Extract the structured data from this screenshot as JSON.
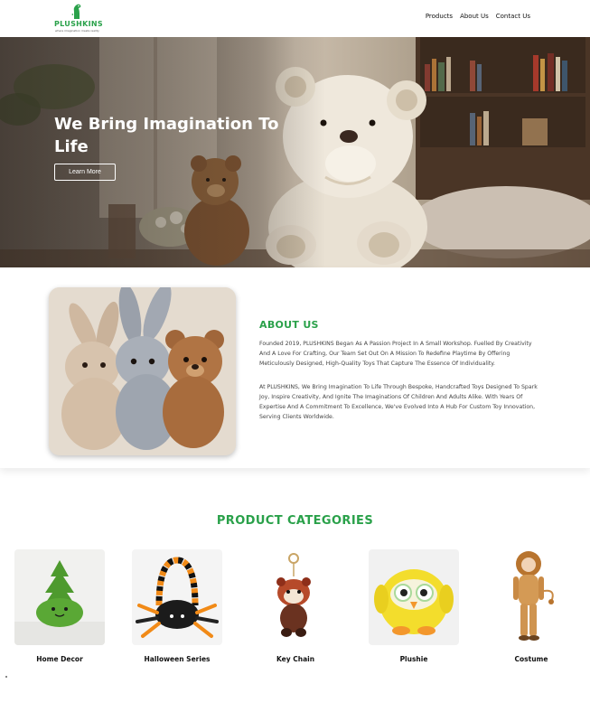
{
  "header": {
    "logo_text": "PLUSHKINS",
    "logo_tagline": "where imagination meets reality",
    "nav": [
      "Products",
      "About Us",
      "Contact Us"
    ]
  },
  "hero": {
    "title": "We Bring Imagination To Life",
    "button_label": "Learn More"
  },
  "about": {
    "title": "ABOUT US",
    "paragraph1": "Founded 2019, PLUSHKINS Began As A Passion Project In A Small Workshop. Fuelled By Creativity And A Love For Crafting, Our Team Set Out On A Mission To Redefine Playtime By Offering Meticulously Designed, High-Quality Toys That Capture The Essence Of Individuality.",
    "paragraph2": "At PLUSHKINS, We Bring Imagination To Life Through Bespoke, Handcrafted Toys Designed To Spark Joy, Inspire Creativity, And Ignite The Imaginations Of Children And Adults Alike. With Years Of Expertise And A Commitment To Excellence, We've Evolved Into A Hub For Custom Toy Innovation, Serving Clients Worldwide."
  },
  "categories": {
    "title": "PRODUCT CATEGORIES",
    "items": [
      {
        "label": "Home Decor",
        "icon": "green-tree-plush-icon"
      },
      {
        "label": "Halloween Series",
        "icon": "spider-basket-icon"
      },
      {
        "label": "Key Chain",
        "icon": "red-panda-keychain-icon"
      },
      {
        "label": "Plushie",
        "icon": "yellow-owl-plush-icon"
      },
      {
        "label": "Costume",
        "icon": "lion-costume-icon"
      }
    ]
  },
  "colors": {
    "brand_green": "#2aa14a",
    "text_dark": "#111111",
    "hero_text": "#ffffff"
  }
}
